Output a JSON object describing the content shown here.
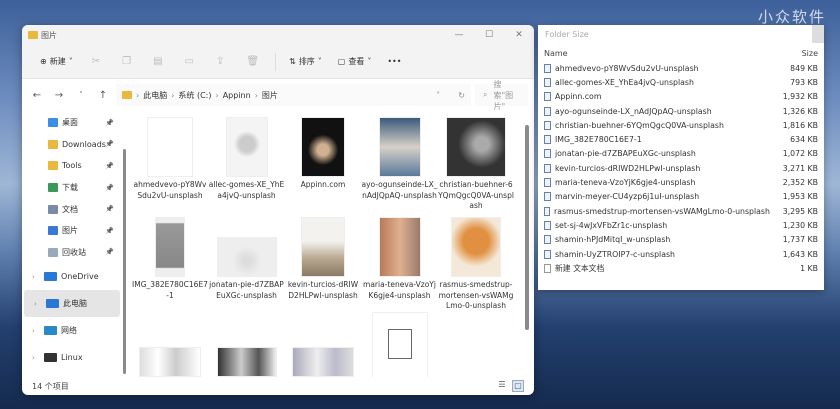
{
  "watermark": "小众软件",
  "explorer": {
    "title": "图片",
    "window_controls": [
      "—",
      "☐",
      "✕"
    ],
    "toolbar": {
      "new": "新建",
      "sort": "排序",
      "view": "查看",
      "more": "•••"
    },
    "breadcrumb": [
      "此电脑",
      "系统 (C:)",
      "Appinn",
      "图片"
    ],
    "search_placeholder": "搜索\"图片\"",
    "sidebar": [
      {
        "label": "桌面",
        "color": "#3a8ee6",
        "pinned": true
      },
      {
        "label": "Downloads",
        "color": "#e8b93c",
        "pinned": true
      },
      {
        "label": "Tools",
        "color": "#e8b93c",
        "pinned": true
      },
      {
        "label": "下载",
        "color": "#3a9a5a",
        "pinned": true
      },
      {
        "label": "文档",
        "color": "#7a8aa8",
        "pinned": true
      },
      {
        "label": "图片",
        "color": "#3a78d6",
        "pinned": true
      },
      {
        "label": "回收站",
        "color": "#9ab",
        "pinned": true
      }
    ],
    "sidebar_top": [
      {
        "label": "OneDrive",
        "color": "#2a78d6",
        "selected": false
      },
      {
        "label": "此电脑",
        "color": "#2a78d6",
        "selected": true
      },
      {
        "label": "网络",
        "color": "#2a88c6",
        "selected": false
      },
      {
        "label": "Linux",
        "color": "#333",
        "selected": false
      }
    ],
    "items": [
      {
        "label": "ahmedvevo-pY8WvSdu2vU-unsplash",
        "thumb": "linear-gradient(160deg,#3a2a22,#6b4a3a 50,#2a2222)"
      },
      {
        "label": "allec-gomes-XE_YhEa4jvQ-unsplash",
        "thumb": "radial-gradient(circle at 50% 45%,#ccc 20%,#f4f4f4 35%)"
      },
      {
        "label": "Appinn.com",
        "thumb": "radial-gradient(circle at 50% 55%,#d0b090 15%,#111 40%)"
      },
      {
        "label": "ayo-ogunseinde-LX_nAdJQpAQ-unsplash",
        "thumb": "linear-gradient(180deg,#3a5a7a,#d8d0c8 50%,#5a7a9a)"
      },
      {
        "label": "christian-buehner-6YQmQgcQ0VA-unsplash",
        "thumb": "radial-gradient(circle at 60% 45%,#aaa 15%,#333 50%)"
      },
      {
        "label": "IMG_382E780C16E7-1",
        "thumb": "linear-gradient(180deg,#eee 8%,#999 10%,#888 85%,#eee 87%)"
      },
      {
        "label": "jonatan-pie-d7ZBAPEuXGc-unsplash",
        "thumb": "radial-gradient(circle at 50% 60%,#ddd 10%,#eee 40%)"
      },
      {
        "label": "kevin-turcios-dRIWD2HLPwI-unsplash",
        "thumb": "linear-gradient(180deg,#f4f2ee 40%,#b8a890 70%,#8a7a66)"
      },
      {
        "label": "maria-teneva-VzoYjK6gje4-unsplash",
        "thumb": "linear-gradient(90deg,#b87a5a,#e0b090 50%,#9a7a6a)"
      },
      {
        "label": "rasmus-smedstrup-mortensen-vsWAMgLmo-0-unsplash",
        "thumb": "radial-gradient(circle at 50% 40%,#e09040 30%,#f4e8d8 60%)"
      },
      {
        "label": "",
        "thumb": "linear-gradient(90deg,#ddd,#fff 30%,#ccc 60%,#fff)"
      },
      {
        "label": "",
        "thumb": "linear-gradient(90deg,#333,#ccc 40%,#555 70%,#eee)"
      },
      {
        "label": "",
        "thumb": "linear-gradient(90deg,#aab,#eee 40%,#bbc 70%,#ddd)"
      },
      {
        "label": "",
        "thumb": "file"
      }
    ],
    "status": "14 个项目"
  },
  "folder_size": {
    "title": "Folder Size",
    "columns": {
      "name": "Name",
      "size": "Size"
    },
    "rows": [
      {
        "name": "ahmedvevo-pY8WvSdu2vU-unsplash",
        "size": "849 KB"
      },
      {
        "name": "allec-gomes-XE_YhEa4jvQ-unsplash",
        "size": "793 KB"
      },
      {
        "name": "Appinn.com",
        "size": "1,932 KB"
      },
      {
        "name": "ayo-ogunseinde-LX_nAdJQpAQ-unsplash",
        "size": "1,326 KB"
      },
      {
        "name": "christian-buehner-6YQmQgcQ0VA-unsplash",
        "size": "1,816 KB"
      },
      {
        "name": "IMG_382E780C16E7-1",
        "size": "634 KB"
      },
      {
        "name": "jonatan-pie-d7ZBAPEuXGc-unsplash",
        "size": "1,072 KB"
      },
      {
        "name": "kevin-turcios-dRIWD2HLPwI-unsplash",
        "size": "3,271 KB"
      },
      {
        "name": "maria-teneva-VzoYjK6gje4-unsplash",
        "size": "2,352 KB"
      },
      {
        "name": "marvin-meyer-CU4yzp6j1uI-unsplash",
        "size": "1,953 KB"
      },
      {
        "name": "rasmus-smedstrup-mortensen-vsWAMgLmo-0-unsplash",
        "size": "3,295 KB"
      },
      {
        "name": "set-sj-4wJxVFbZr1c-unsplash",
        "size": "1,230 KB"
      },
      {
        "name": "shamin-hPJdMitqI_w-unsplash",
        "size": "1,737 KB"
      },
      {
        "name": "shamin-UyZTROIP7-c-unsplash",
        "size": "1,643 KB"
      },
      {
        "name": "新建 文本文档",
        "size": "1 KB",
        "type": "text"
      }
    ]
  }
}
